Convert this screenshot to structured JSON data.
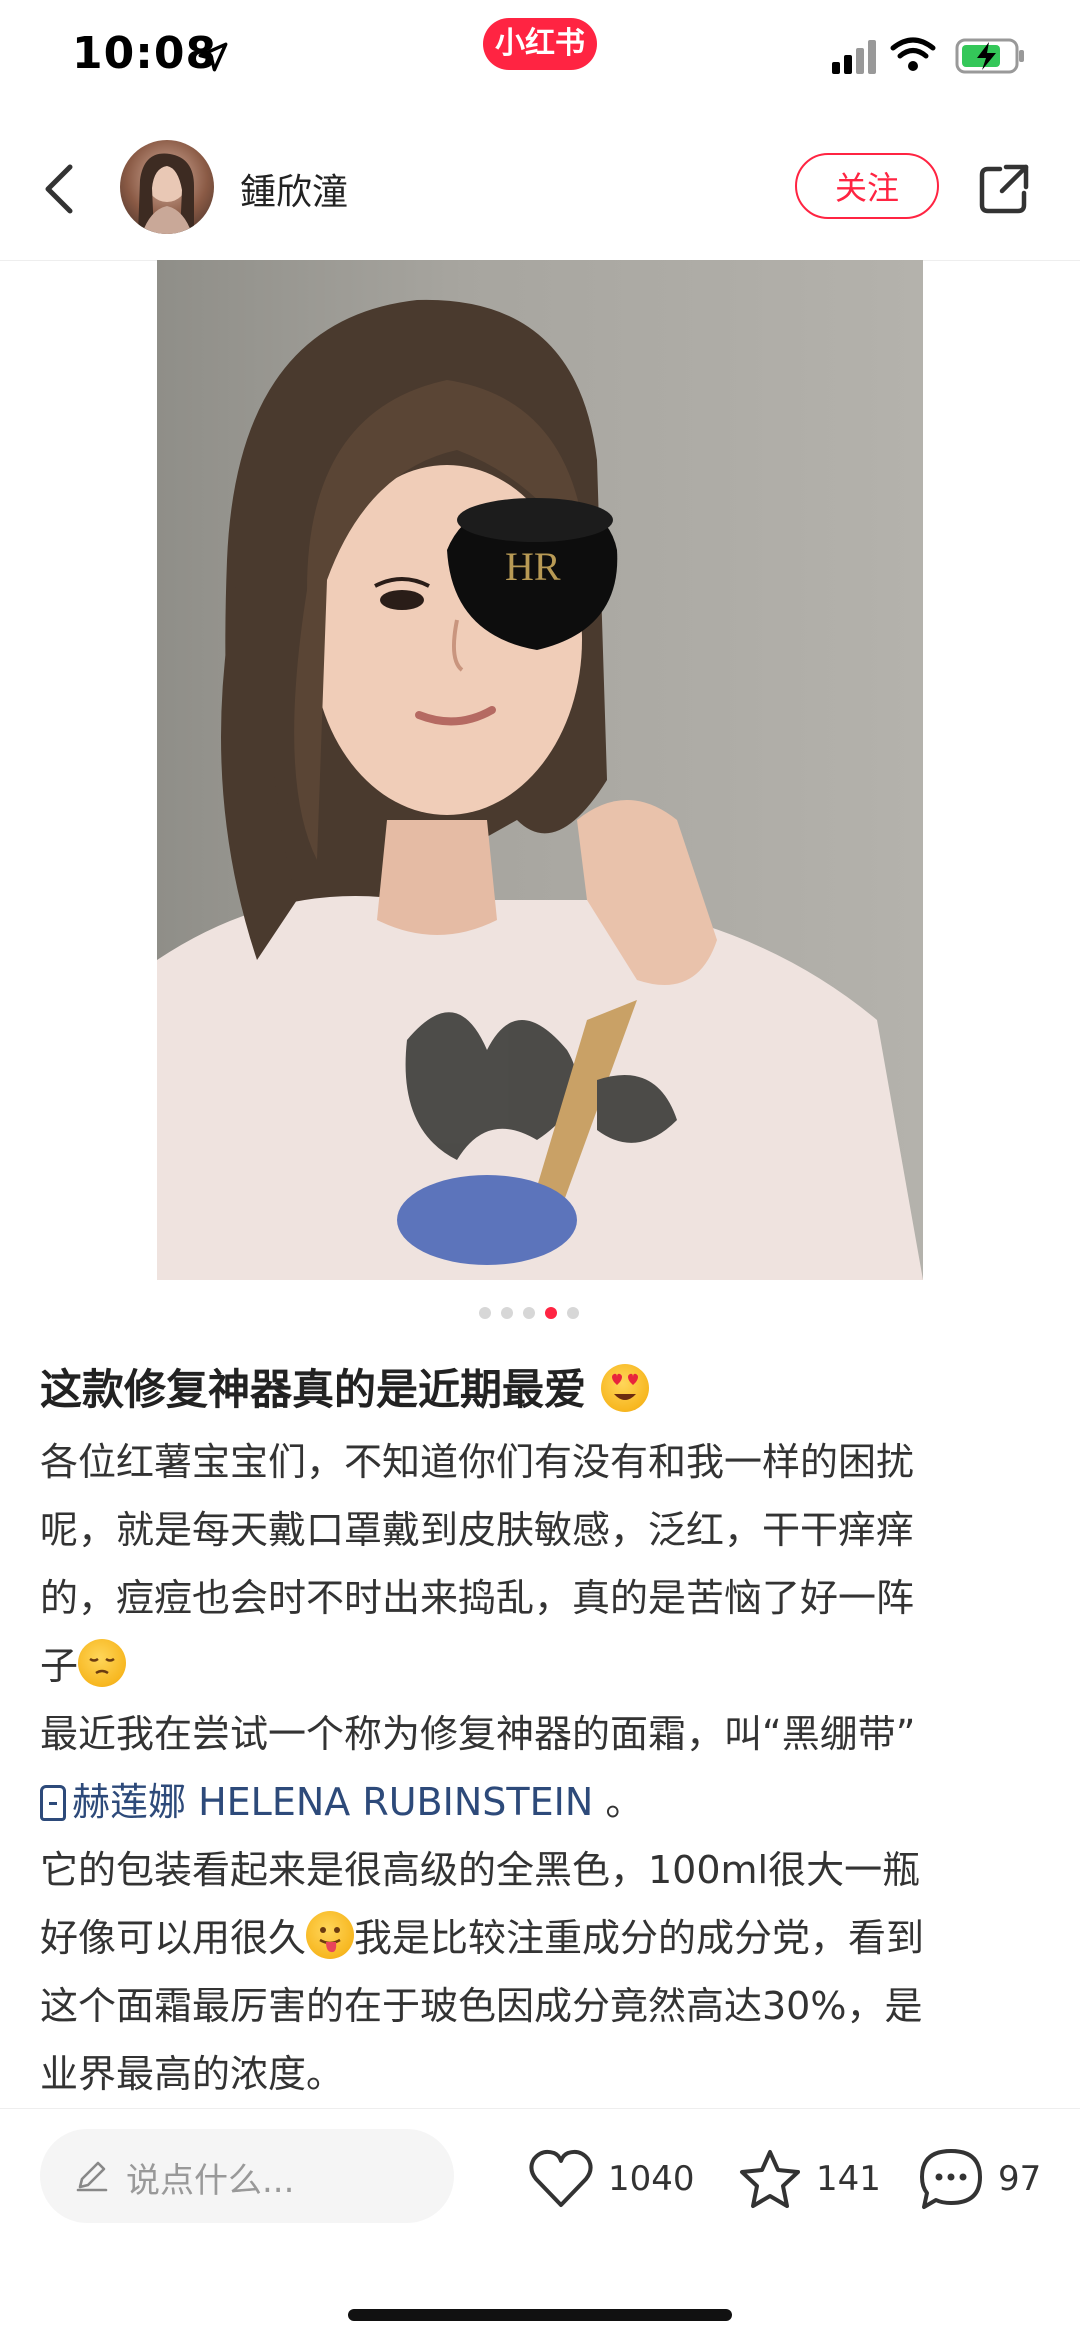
{
  "status_bar": {
    "time": "10:08",
    "app_badge": "小红书",
    "icons": [
      "location-arrow-icon",
      "signal-icon",
      "wifi-icon",
      "battery-charging-icon"
    ]
  },
  "header": {
    "back_icon": "chevron-left-icon",
    "author_name": "鍾欣潼",
    "follow_label": "关注",
    "share_icon": "share-icon"
  },
  "carousel": {
    "total": 5,
    "active_index": 3
  },
  "post": {
    "title": "这款修复神器真的是近期最爱",
    "body": {
      "p1_l1": "各位红薯宝宝们，不知道你们有没有和我一样的困扰",
      "p1_l2": "呢，就是每天戴口罩戴到皮肤敏感，泛红，干干痒痒",
      "p1_l3": "的，痘痘也会时不时出来捣乱，真的是苦恼了好一阵",
      "p1_l4": "子",
      "p2_l1": "最近我在尝试一个称为修复神器的面霜，叫“黑绷带”",
      "p2_brand": "赫莲娜 HELENA RUBINSTEIN",
      "p2_end": "。",
      "p3_l1": "它的包装看起来是很高级的全黑色，100ml很大一瓶",
      "p3_l2a": "好像可以用很久",
      "p3_l2b": "我是比较注重成分的成分党，看到",
      "p3_l3": "这个面霜最厉害的在于玻色因成分竟然高达30%，是",
      "p3_l4": "业界最高的浓度。"
    },
    "emojis": [
      "heart-eyes-emoji",
      "pensive-emoji",
      "tongue-emoji"
    ]
  },
  "bottom_bar": {
    "comment_placeholder": "说点什么...",
    "likes": "1040",
    "collects": "141",
    "comments": "97"
  },
  "colors": {
    "brand_red": "#ff2442",
    "link_blue": "#2d4a7a"
  }
}
